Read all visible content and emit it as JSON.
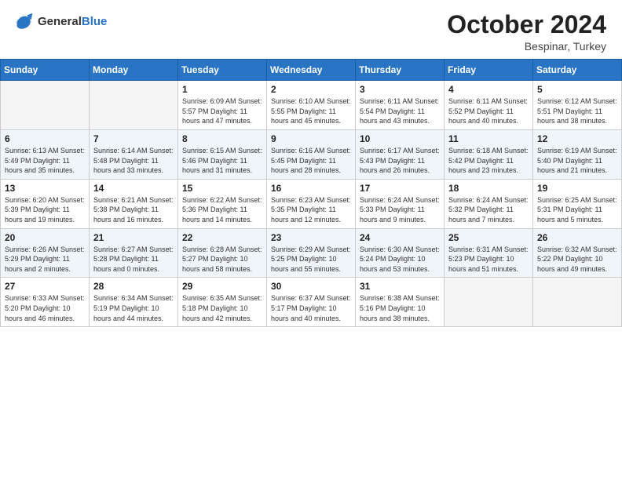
{
  "header": {
    "logo_general": "General",
    "logo_blue": "Blue",
    "month_year": "October 2024",
    "location": "Bespinar, Turkey"
  },
  "weekdays": [
    "Sunday",
    "Monday",
    "Tuesday",
    "Wednesday",
    "Thursday",
    "Friday",
    "Saturday"
  ],
  "weeks": [
    [
      {
        "day": "",
        "info": ""
      },
      {
        "day": "",
        "info": ""
      },
      {
        "day": "1",
        "info": "Sunrise: 6:09 AM\nSunset: 5:57 PM\nDaylight: 11 hours and 47 minutes."
      },
      {
        "day": "2",
        "info": "Sunrise: 6:10 AM\nSunset: 5:55 PM\nDaylight: 11 hours and 45 minutes."
      },
      {
        "day": "3",
        "info": "Sunrise: 6:11 AM\nSunset: 5:54 PM\nDaylight: 11 hours and 43 minutes."
      },
      {
        "day": "4",
        "info": "Sunrise: 6:11 AM\nSunset: 5:52 PM\nDaylight: 11 hours and 40 minutes."
      },
      {
        "day": "5",
        "info": "Sunrise: 6:12 AM\nSunset: 5:51 PM\nDaylight: 11 hours and 38 minutes."
      }
    ],
    [
      {
        "day": "6",
        "info": "Sunrise: 6:13 AM\nSunset: 5:49 PM\nDaylight: 11 hours and 35 minutes."
      },
      {
        "day": "7",
        "info": "Sunrise: 6:14 AM\nSunset: 5:48 PM\nDaylight: 11 hours and 33 minutes."
      },
      {
        "day": "8",
        "info": "Sunrise: 6:15 AM\nSunset: 5:46 PM\nDaylight: 11 hours and 31 minutes."
      },
      {
        "day": "9",
        "info": "Sunrise: 6:16 AM\nSunset: 5:45 PM\nDaylight: 11 hours and 28 minutes."
      },
      {
        "day": "10",
        "info": "Sunrise: 6:17 AM\nSunset: 5:43 PM\nDaylight: 11 hours and 26 minutes."
      },
      {
        "day": "11",
        "info": "Sunrise: 6:18 AM\nSunset: 5:42 PM\nDaylight: 11 hours and 23 minutes."
      },
      {
        "day": "12",
        "info": "Sunrise: 6:19 AM\nSunset: 5:40 PM\nDaylight: 11 hours and 21 minutes."
      }
    ],
    [
      {
        "day": "13",
        "info": "Sunrise: 6:20 AM\nSunset: 5:39 PM\nDaylight: 11 hours and 19 minutes."
      },
      {
        "day": "14",
        "info": "Sunrise: 6:21 AM\nSunset: 5:38 PM\nDaylight: 11 hours and 16 minutes."
      },
      {
        "day": "15",
        "info": "Sunrise: 6:22 AM\nSunset: 5:36 PM\nDaylight: 11 hours and 14 minutes."
      },
      {
        "day": "16",
        "info": "Sunrise: 6:23 AM\nSunset: 5:35 PM\nDaylight: 11 hours and 12 minutes."
      },
      {
        "day": "17",
        "info": "Sunrise: 6:24 AM\nSunset: 5:33 PM\nDaylight: 11 hours and 9 minutes."
      },
      {
        "day": "18",
        "info": "Sunrise: 6:24 AM\nSunset: 5:32 PM\nDaylight: 11 hours and 7 minutes."
      },
      {
        "day": "19",
        "info": "Sunrise: 6:25 AM\nSunset: 5:31 PM\nDaylight: 11 hours and 5 minutes."
      }
    ],
    [
      {
        "day": "20",
        "info": "Sunrise: 6:26 AM\nSunset: 5:29 PM\nDaylight: 11 hours and 2 minutes."
      },
      {
        "day": "21",
        "info": "Sunrise: 6:27 AM\nSunset: 5:28 PM\nDaylight: 11 hours and 0 minutes."
      },
      {
        "day": "22",
        "info": "Sunrise: 6:28 AM\nSunset: 5:27 PM\nDaylight: 10 hours and 58 minutes."
      },
      {
        "day": "23",
        "info": "Sunrise: 6:29 AM\nSunset: 5:25 PM\nDaylight: 10 hours and 55 minutes."
      },
      {
        "day": "24",
        "info": "Sunrise: 6:30 AM\nSunset: 5:24 PM\nDaylight: 10 hours and 53 minutes."
      },
      {
        "day": "25",
        "info": "Sunrise: 6:31 AM\nSunset: 5:23 PM\nDaylight: 10 hours and 51 minutes."
      },
      {
        "day": "26",
        "info": "Sunrise: 6:32 AM\nSunset: 5:22 PM\nDaylight: 10 hours and 49 minutes."
      }
    ],
    [
      {
        "day": "27",
        "info": "Sunrise: 6:33 AM\nSunset: 5:20 PM\nDaylight: 10 hours and 46 minutes."
      },
      {
        "day": "28",
        "info": "Sunrise: 6:34 AM\nSunset: 5:19 PM\nDaylight: 10 hours and 44 minutes."
      },
      {
        "day": "29",
        "info": "Sunrise: 6:35 AM\nSunset: 5:18 PM\nDaylight: 10 hours and 42 minutes."
      },
      {
        "day": "30",
        "info": "Sunrise: 6:37 AM\nSunset: 5:17 PM\nDaylight: 10 hours and 40 minutes."
      },
      {
        "day": "31",
        "info": "Sunrise: 6:38 AM\nSunset: 5:16 PM\nDaylight: 10 hours and 38 minutes."
      },
      {
        "day": "",
        "info": ""
      },
      {
        "day": "",
        "info": ""
      }
    ]
  ]
}
